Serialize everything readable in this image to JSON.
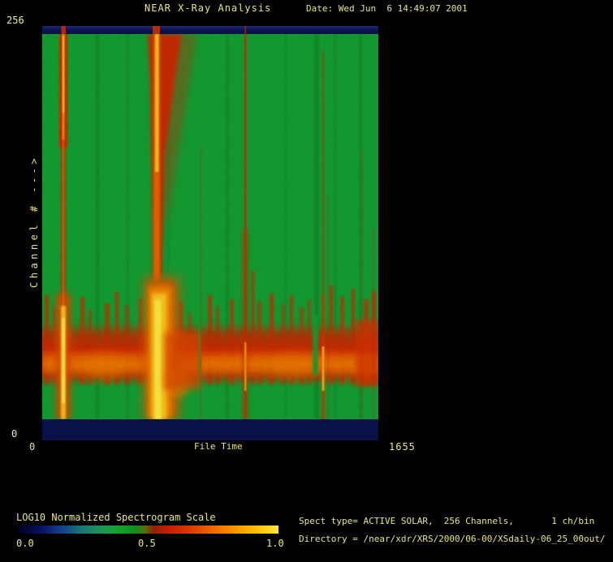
{
  "header": {
    "title": "NEAR X-Ray Analysis",
    "date_label": "Date: Wed Jun  6 14:49:07 2001"
  },
  "plot": {
    "y_axis": {
      "label": "Channel # --->",
      "max_tick": "256",
      "min_tick": "0"
    },
    "x_axis": {
      "label": "File Time",
      "min_tick": "0",
      "max_tick": "1655"
    }
  },
  "legend": {
    "title": "LOG10 Normalized Spectrogram Scale",
    "ticks": [
      "0.0",
      "0.5",
      "1.0"
    ]
  },
  "info": {
    "line1": "Spect type= ACTIVE SOLAR,  256 Channels,       1 ch/bin",
    "line2": "Directory = /near/xdr/XRS/2000/06-00/XSdaily-06_25_00out/"
  },
  "colors": {
    "background": "#000000",
    "text_yellow": "#e9e48c",
    "text_pale": "#efedb0",
    "plot_green": "#14a032",
    "flare_red": "#d42806",
    "band_orange": "#f27a00",
    "flare_yellow": "#ffe636",
    "frame_navy": "#0a1148"
  },
  "chart_data": {
    "type": "heatmap",
    "title": "NEAR X-Ray Analysis",
    "xlabel": "File Time",
    "ylabel": "Channel #",
    "xlim": [
      0,
      1655
    ],
    "ylim": [
      0,
      256
    ],
    "colorbar": {
      "label": "LOG10 Normalized Spectrogram Scale",
      "range": [
        0.0,
        1.0
      ],
      "tick_values": [
        0.0,
        0.5,
        1.0
      ],
      "gradient_stops": [
        "#02021a",
        "#0a1166",
        "#187a74",
        "#12a228",
        "#8f220a",
        "#c81f05",
        "#ec6400",
        "#ffe636"
      ]
    },
    "background_level": "uniform green ~0.4 across most channels",
    "low_channel_band": {
      "channels": [
        25,
        80
      ],
      "level": "0.6-1.0 (red to orange-yellow), brightest ~0.9-1.0 near File Time 564",
      "note": "broad continuous high-intensity band across all File Time with ragged upper edge spikes"
    },
    "frame_bands": "dark navy (~0.05) strips at channel 0 and channel 256 edges",
    "features": [
      {
        "x_file_time": 104,
        "type": "vertical flare streak, all channels",
        "intensity": "bright, yellow core"
      },
      {
        "x_file_time": 564,
        "type": "vertical flare streak, all channels",
        "intensity": "brightest and widest, yellow core, red fan at high channels"
      },
      {
        "x_file_time": 779,
        "type": "faint narrow flare line",
        "intensity": "weak red"
      },
      {
        "x_file_time": 999,
        "type": "narrow flare line, all channels",
        "intensity": "red"
      },
      {
        "x_file_time": 1351,
        "type": "green gap/notch in low-channel band",
        "intensity": "background level"
      },
      {
        "x_file_time": 1383,
        "type": "narrow flare line",
        "intensity": "red, yellow in band"
      }
    ]
  }
}
